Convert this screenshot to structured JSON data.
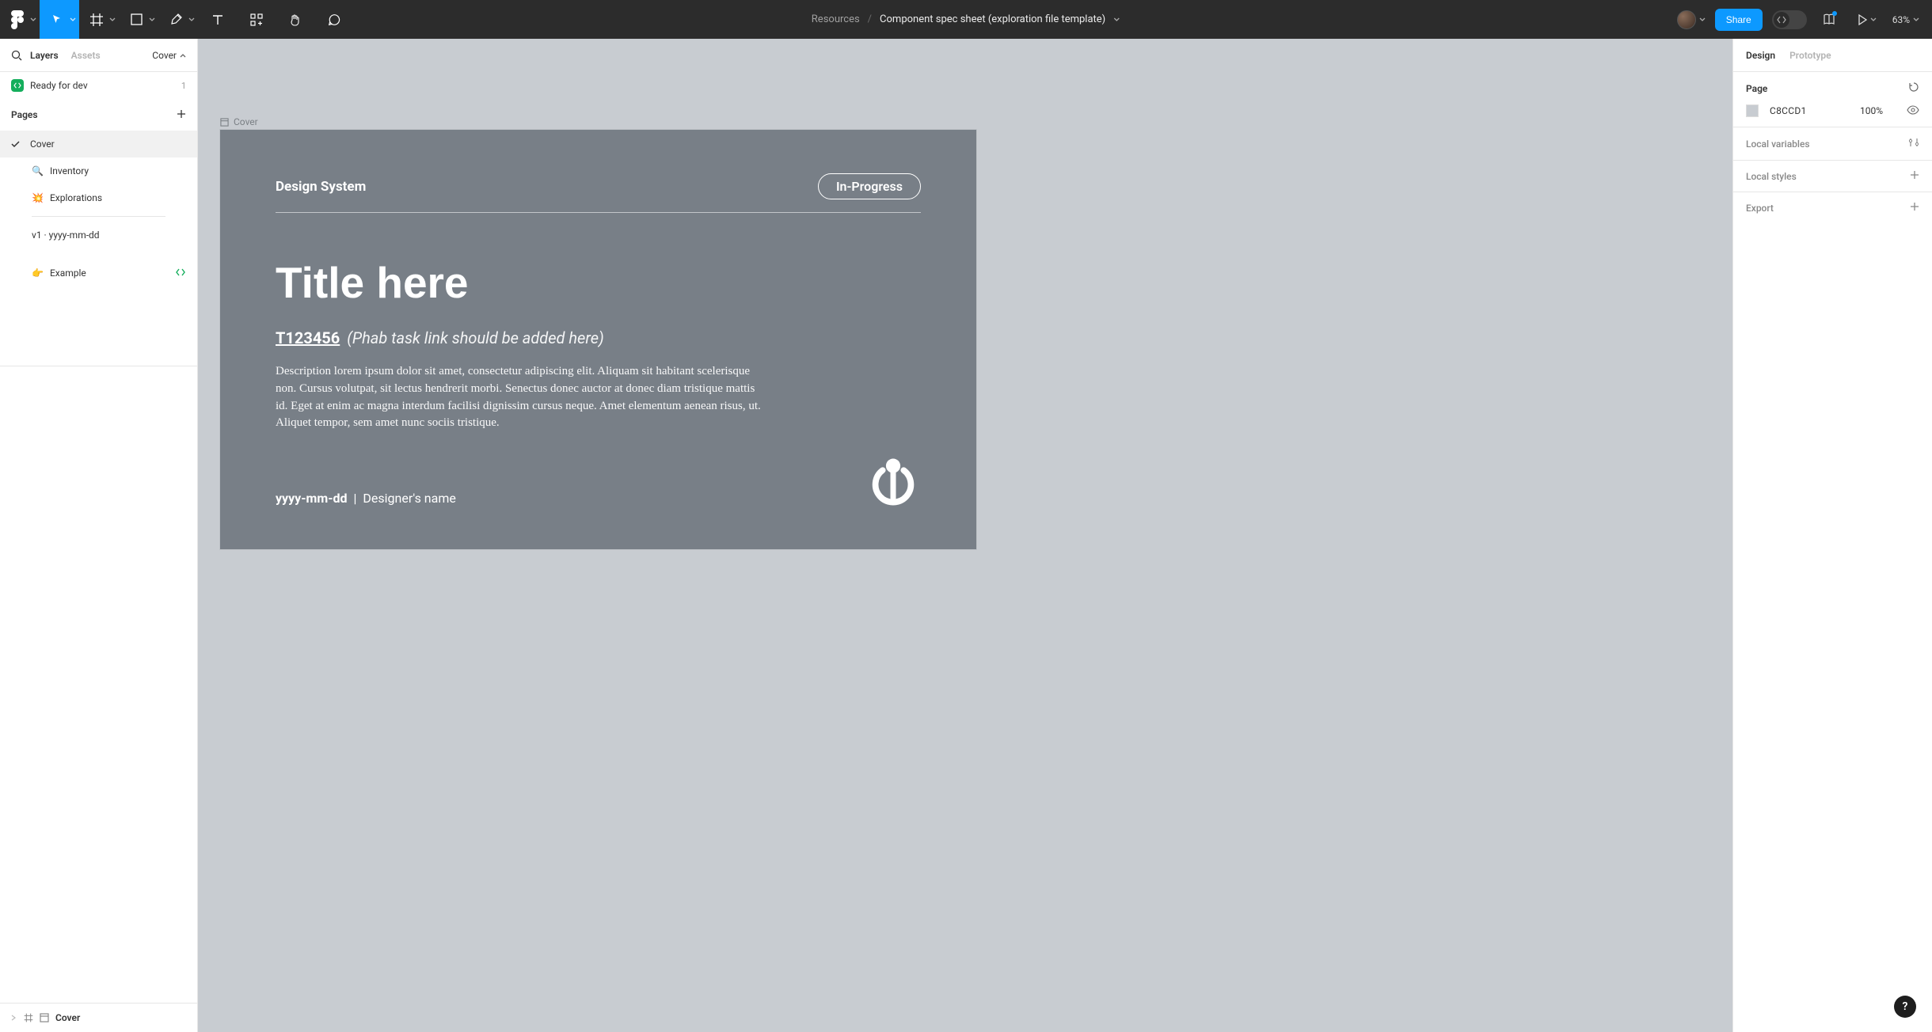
{
  "toolbar": {
    "project": "Resources",
    "file_name": "Component spec sheet (exploration file template)",
    "share_label": "Share",
    "zoom": "63%"
  },
  "left": {
    "tabs": {
      "layers": "Layers",
      "assets": "Assets"
    },
    "page_selector": "Cover",
    "ready_for_dev": {
      "label": "Ready for dev",
      "count": "1"
    },
    "pages_header": "Pages",
    "pages": [
      {
        "name": "Cover",
        "active": true,
        "check": true
      },
      {
        "name": "Inventory",
        "emoji": "🔍",
        "sub": true
      },
      {
        "name": "Explorations",
        "emoji": "💥",
        "sub": true
      },
      {
        "divider": true
      },
      {
        "name": "v1  ·  yyyy-mm-dd",
        "sub": true
      },
      {
        "spacer": true
      },
      {
        "name": "Example",
        "emoji": "👉",
        "sub": true,
        "dev": true
      }
    ],
    "layer": "Cover"
  },
  "canvas": {
    "frame_name": "Cover",
    "cover": {
      "system": "Design System",
      "status": "In-Progress",
      "title": "Title here",
      "task_id": "T123456",
      "task_note": "(Phab task link should be added here)",
      "description": "Description lorem ipsum dolor sit amet, consectetur adipiscing elit. Aliquam sit habitant scelerisque non. Cursus volutpat, sit lectus hendrerit morbi. Senectus donec auctor at donec diam tristique mattis id. Eget at enim ac magna interdum facilisi dignissim cursus neque. Amet elementum aenean risus, ut. Aliquet tempor, sem amet nunc sociis tristique.",
      "date": "yyyy-mm-dd",
      "designer": "Designer's name"
    }
  },
  "right": {
    "tabs": {
      "design": "Design",
      "prototype": "Prototype"
    },
    "page": {
      "label": "Page",
      "color_hex": "C8CCD1",
      "opacity": "100%"
    },
    "local_variables": "Local variables",
    "local_styles": "Local styles",
    "export": "Export"
  },
  "help": "?"
}
